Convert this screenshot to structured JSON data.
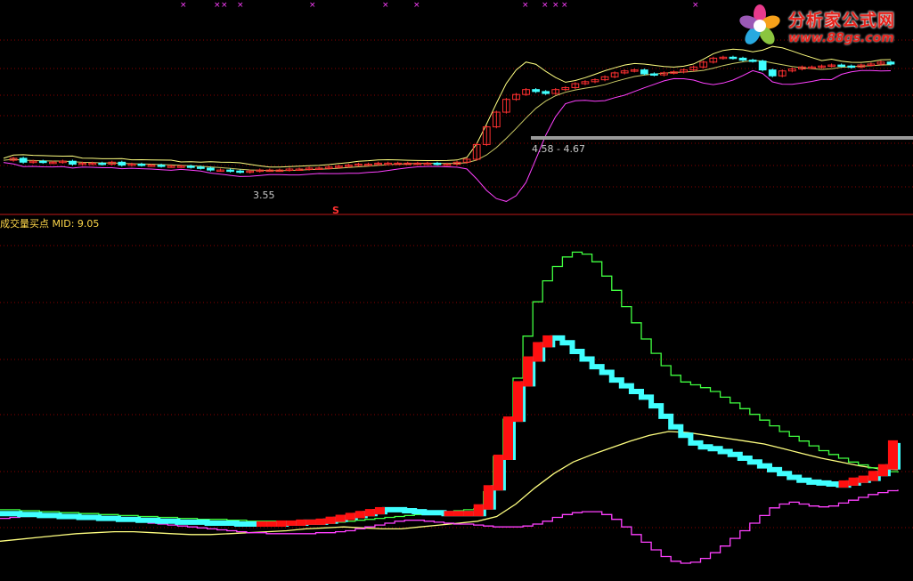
{
  "branding": {
    "name": "分析家公式网",
    "url": "www.88gs.com"
  },
  "indicator": {
    "name": "成交量买点",
    "mid_label": "MID:",
    "mid_value": "9.05"
  },
  "price_panel": {
    "range_label": "4.58 - 4.67",
    "low_label": "3.55",
    "signal_marker": "S"
  },
  "colors": {
    "background": "#000000",
    "grid": "#8b0000",
    "up_candle": "#ff3030",
    "down_candle": "#40ffff",
    "upper_band": "#ffff80",
    "lower_band": "#ff40ff",
    "mid_band": "#ffff80",
    "cross_marker": "#ff40ff",
    "label": "#ffd84a"
  },
  "chart_data": [
    {
      "type": "candlestick",
      "title": "",
      "yrange": [
        3.3,
        4.95
      ],
      "price_labels": [
        "4.58 - 4.67",
        "3.55"
      ],
      "close": [
        3.68,
        3.7,
        3.66,
        3.67,
        3.66,
        3.66,
        3.67,
        3.64,
        3.65,
        3.65,
        3.64,
        3.66,
        3.63,
        3.64,
        3.63,
        3.63,
        3.62,
        3.62,
        3.62,
        3.61,
        3.6,
        3.58,
        3.58,
        3.57,
        3.56,
        3.57,
        3.58,
        3.58,
        3.58,
        3.59,
        3.59,
        3.6,
        3.6,
        3.61,
        3.62,
        3.63,
        3.64,
        3.64,
        3.65,
        3.65,
        3.65,
        3.65,
        3.65,
        3.65,
        3.64,
        3.64,
        3.66,
        3.69,
        3.84,
        4.02,
        4.17,
        4.3,
        4.35,
        4.4,
        4.38,
        4.36,
        4.4,
        4.42,
        4.46,
        4.48,
        4.5,
        4.53,
        4.57,
        4.59,
        4.6,
        4.56,
        4.55,
        4.57,
        4.58,
        4.6,
        4.63,
        4.68,
        4.72,
        4.73,
        4.72,
        4.7,
        4.69,
        4.6,
        4.54,
        4.59,
        4.61,
        4.63,
        4.63,
        4.64,
        4.65,
        4.64,
        4.63,
        4.65,
        4.66,
        4.68,
        4.66
      ]
    },
    {
      "type": "line",
      "title": "成交量买点",
      "mid": 9.05,
      "series": [
        {
          "name": "",
          "color": "#ffff80",
          "values": [
            3.7,
            3.9,
            4.1,
            4.3,
            4.5,
            4.6,
            4.7,
            4.7,
            4.6,
            4.5,
            4.4,
            4.4,
            4.5,
            4.6,
            4.7,
            4.8,
            5.0,
            5.1,
            5.2,
            5.1,
            5.0,
            5.0,
            5.2,
            5.4,
            5.6,
            5.8,
            6.3,
            7.6,
            9.3,
            10.8,
            12.0,
            12.8,
            13.5,
            14.2,
            14.8,
            15.2,
            15.1,
            14.8,
            14.5,
            14.2,
            13.9,
            13.4,
            12.9,
            12.4,
            12.0,
            11.6,
            11.3,
            11.2
          ]
        },
        {
          "name": "",
          "color": "#ff40ff",
          "values": [
            6.1,
            6.2,
            6.3,
            6.4,
            6.5,
            6.6,
            6.5,
            6.4,
            6.3,
            6.2,
            6.1,
            6.0,
            5.9,
            5.8,
            5.7,
            5.6,
            5.5,
            5.4,
            5.3,
            5.2,
            5.1,
            5.0,
            4.9,
            4.8,
            4.7,
            4.6,
            4.6,
            4.5,
            4.5,
            4.5,
            4.5,
            4.5,
            4.6,
            4.6,
            4.7,
            4.8,
            5.0,
            5.2,
            5.4,
            5.6,
            5.8,
            5.9,
            5.9,
            5.8,
            5.7,
            5.6,
            5.5,
            5.5,
            5.4,
            5.3,
            5.2,
            5.2,
            5.2,
            5.3,
            5.5,
            5.8,
            6.2,
            6.5,
            6.7,
            6.8,
            6.8,
            6.5,
            6.0,
            5.2,
            4.4,
            3.6,
            2.8,
            2.1,
            1.6,
            1.4,
            1.5,
            1.9,
            2.5,
            3.2,
            4.0,
            4.8,
            5.6,
            6.4,
            7.2,
            7.6,
            7.8,
            7.6,
            7.4,
            7.3,
            7.4,
            7.7,
            8.0,
            8.3,
            8.6,
            8.8,
            9.0,
            9.1
          ]
        },
        {
          "name": "",
          "color": "#40ff40",
          "values": [
            7.0,
            7.0,
            6.9,
            6.9,
            6.8,
            6.8,
            6.7,
            6.7,
            6.6,
            6.6,
            6.5,
            6.5,
            6.4,
            6.4,
            6.3,
            6.3,
            6.2,
            6.2,
            6.1,
            6.1,
            6.0,
            6.0,
            6.0,
            5.9,
            5.9,
            5.8,
            5.8,
            5.8,
            5.7,
            5.7,
            5.6,
            5.6,
            5.6,
            5.6,
            5.7,
            5.8,
            5.9,
            6.0,
            6.1,
            6.2,
            6.3,
            6.4,
            6.5,
            6.6,
            6.7,
            6.8,
            6.9,
            7.0,
            7.1,
            8.9,
            12.6,
            16.5,
            20.8,
            25.2,
            28.8,
            31.0,
            32.5,
            33.5,
            34.0,
            33.8,
            33.0,
            31.5,
            30.0,
            28.3,
            26.6,
            24.9,
            23.4,
            22.1,
            21.1,
            20.4,
            20.1,
            19.8,
            19.4,
            18.8,
            18.2,
            17.6,
            17.0,
            16.4,
            15.8,
            15.2,
            14.7,
            14.2,
            13.7,
            13.2,
            12.8,
            12.4,
            12.0,
            11.7,
            11.4,
            11.2,
            11.0,
            10.9
          ]
        },
        {
          "name": "",
          "color": "#40ffff",
          "values": [
            6.6,
            6.6,
            6.5,
            6.5,
            6.4,
            6.4,
            6.3,
            6.3,
            6.2,
            6.2,
            6.1,
            6.1,
            6.0,
            6.0,
            5.9,
            5.9,
            5.8,
            5.8,
            5.7,
            5.7,
            5.7,
            5.6,
            5.6,
            5.6,
            5.5,
            5.5,
            5.5,
            5.5,
            5.5,
            5.6,
            5.6,
            5.7,
            5.7,
            5.8,
            6.0,
            6.2,
            6.4,
            6.6,
            6.8,
            7.0,
            7.0,
            6.9,
            6.8,
            6.7,
            6.7,
            6.6,
            6.6,
            6.6,
            6.6,
            7.3,
            9.3,
            12.5,
            16.5,
            20.2,
            22.8,
            24.3,
            25.0,
            24.5,
            23.6,
            22.8,
            22.0,
            21.4,
            20.6,
            20.0,
            19.4,
            18.8,
            17.9,
            16.8,
            15.7,
            14.8,
            14.0,
            13.6,
            13.4,
            13.1,
            12.8,
            12.4,
            12.0,
            11.6,
            11.2,
            10.8,
            10.4,
            10.1,
            9.9,
            9.8,
            9.7,
            9.6,
            9.8,
            10.1,
            10.3,
            10.8,
            11.5,
            14.0
          ]
        }
      ]
    }
  ]
}
